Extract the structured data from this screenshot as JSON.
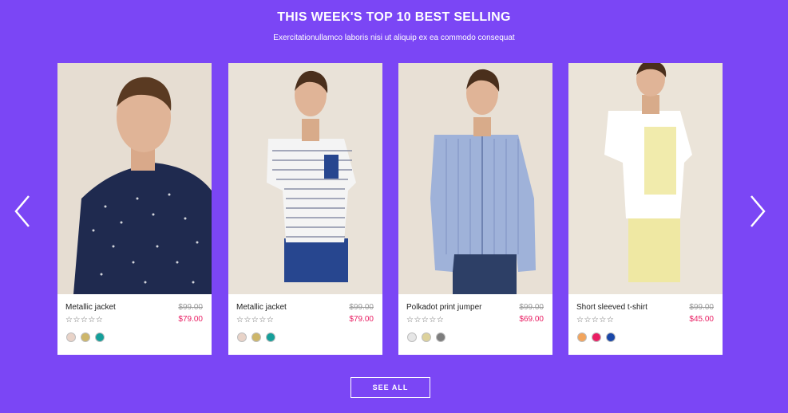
{
  "section": {
    "title": "THIS WEEK'S TOP 10 BEST SELLING",
    "subtitle": "Exercitationullamco laboris nisi ut aliquip ex ea commodo consequat"
  },
  "navigation": {
    "prev_icon": "chevron-left-icon",
    "next_icon": "chevron-right-icon"
  },
  "products": [
    {
      "name": "Metallic jacket",
      "old_price": "$99.00",
      "price": "$79.00",
      "rating_stars": "☆☆☆☆☆",
      "swatches": [
        "#e8d3c8",
        "#cdb66a",
        "#159f9a"
      ]
    },
    {
      "name": "Metallic jacket",
      "old_price": "$99.00",
      "price": "$79.00",
      "rating_stars": "☆☆☆☆☆",
      "swatches": [
        "#e8d3c8",
        "#cdb66a",
        "#159f9a"
      ]
    },
    {
      "name": "Polkadot print jumper",
      "old_price": "$99.00",
      "price": "$69.00",
      "rating_stars": "☆☆☆☆☆",
      "swatches": [
        "#e6e6e6",
        "#ddd29c",
        "#7d7d7d"
      ]
    },
    {
      "name": "Short sleeved t-shirt",
      "old_price": "$99.00",
      "price": "$45.00",
      "rating_stars": "☆☆☆☆☆",
      "swatches": [
        "#f2a45c",
        "#e91e63",
        "#1a47a8"
      ]
    }
  ],
  "cta": {
    "see_all_label": "SEE ALL"
  },
  "colors": {
    "background": "#7b46f5",
    "sale_price": "#e91e63"
  }
}
